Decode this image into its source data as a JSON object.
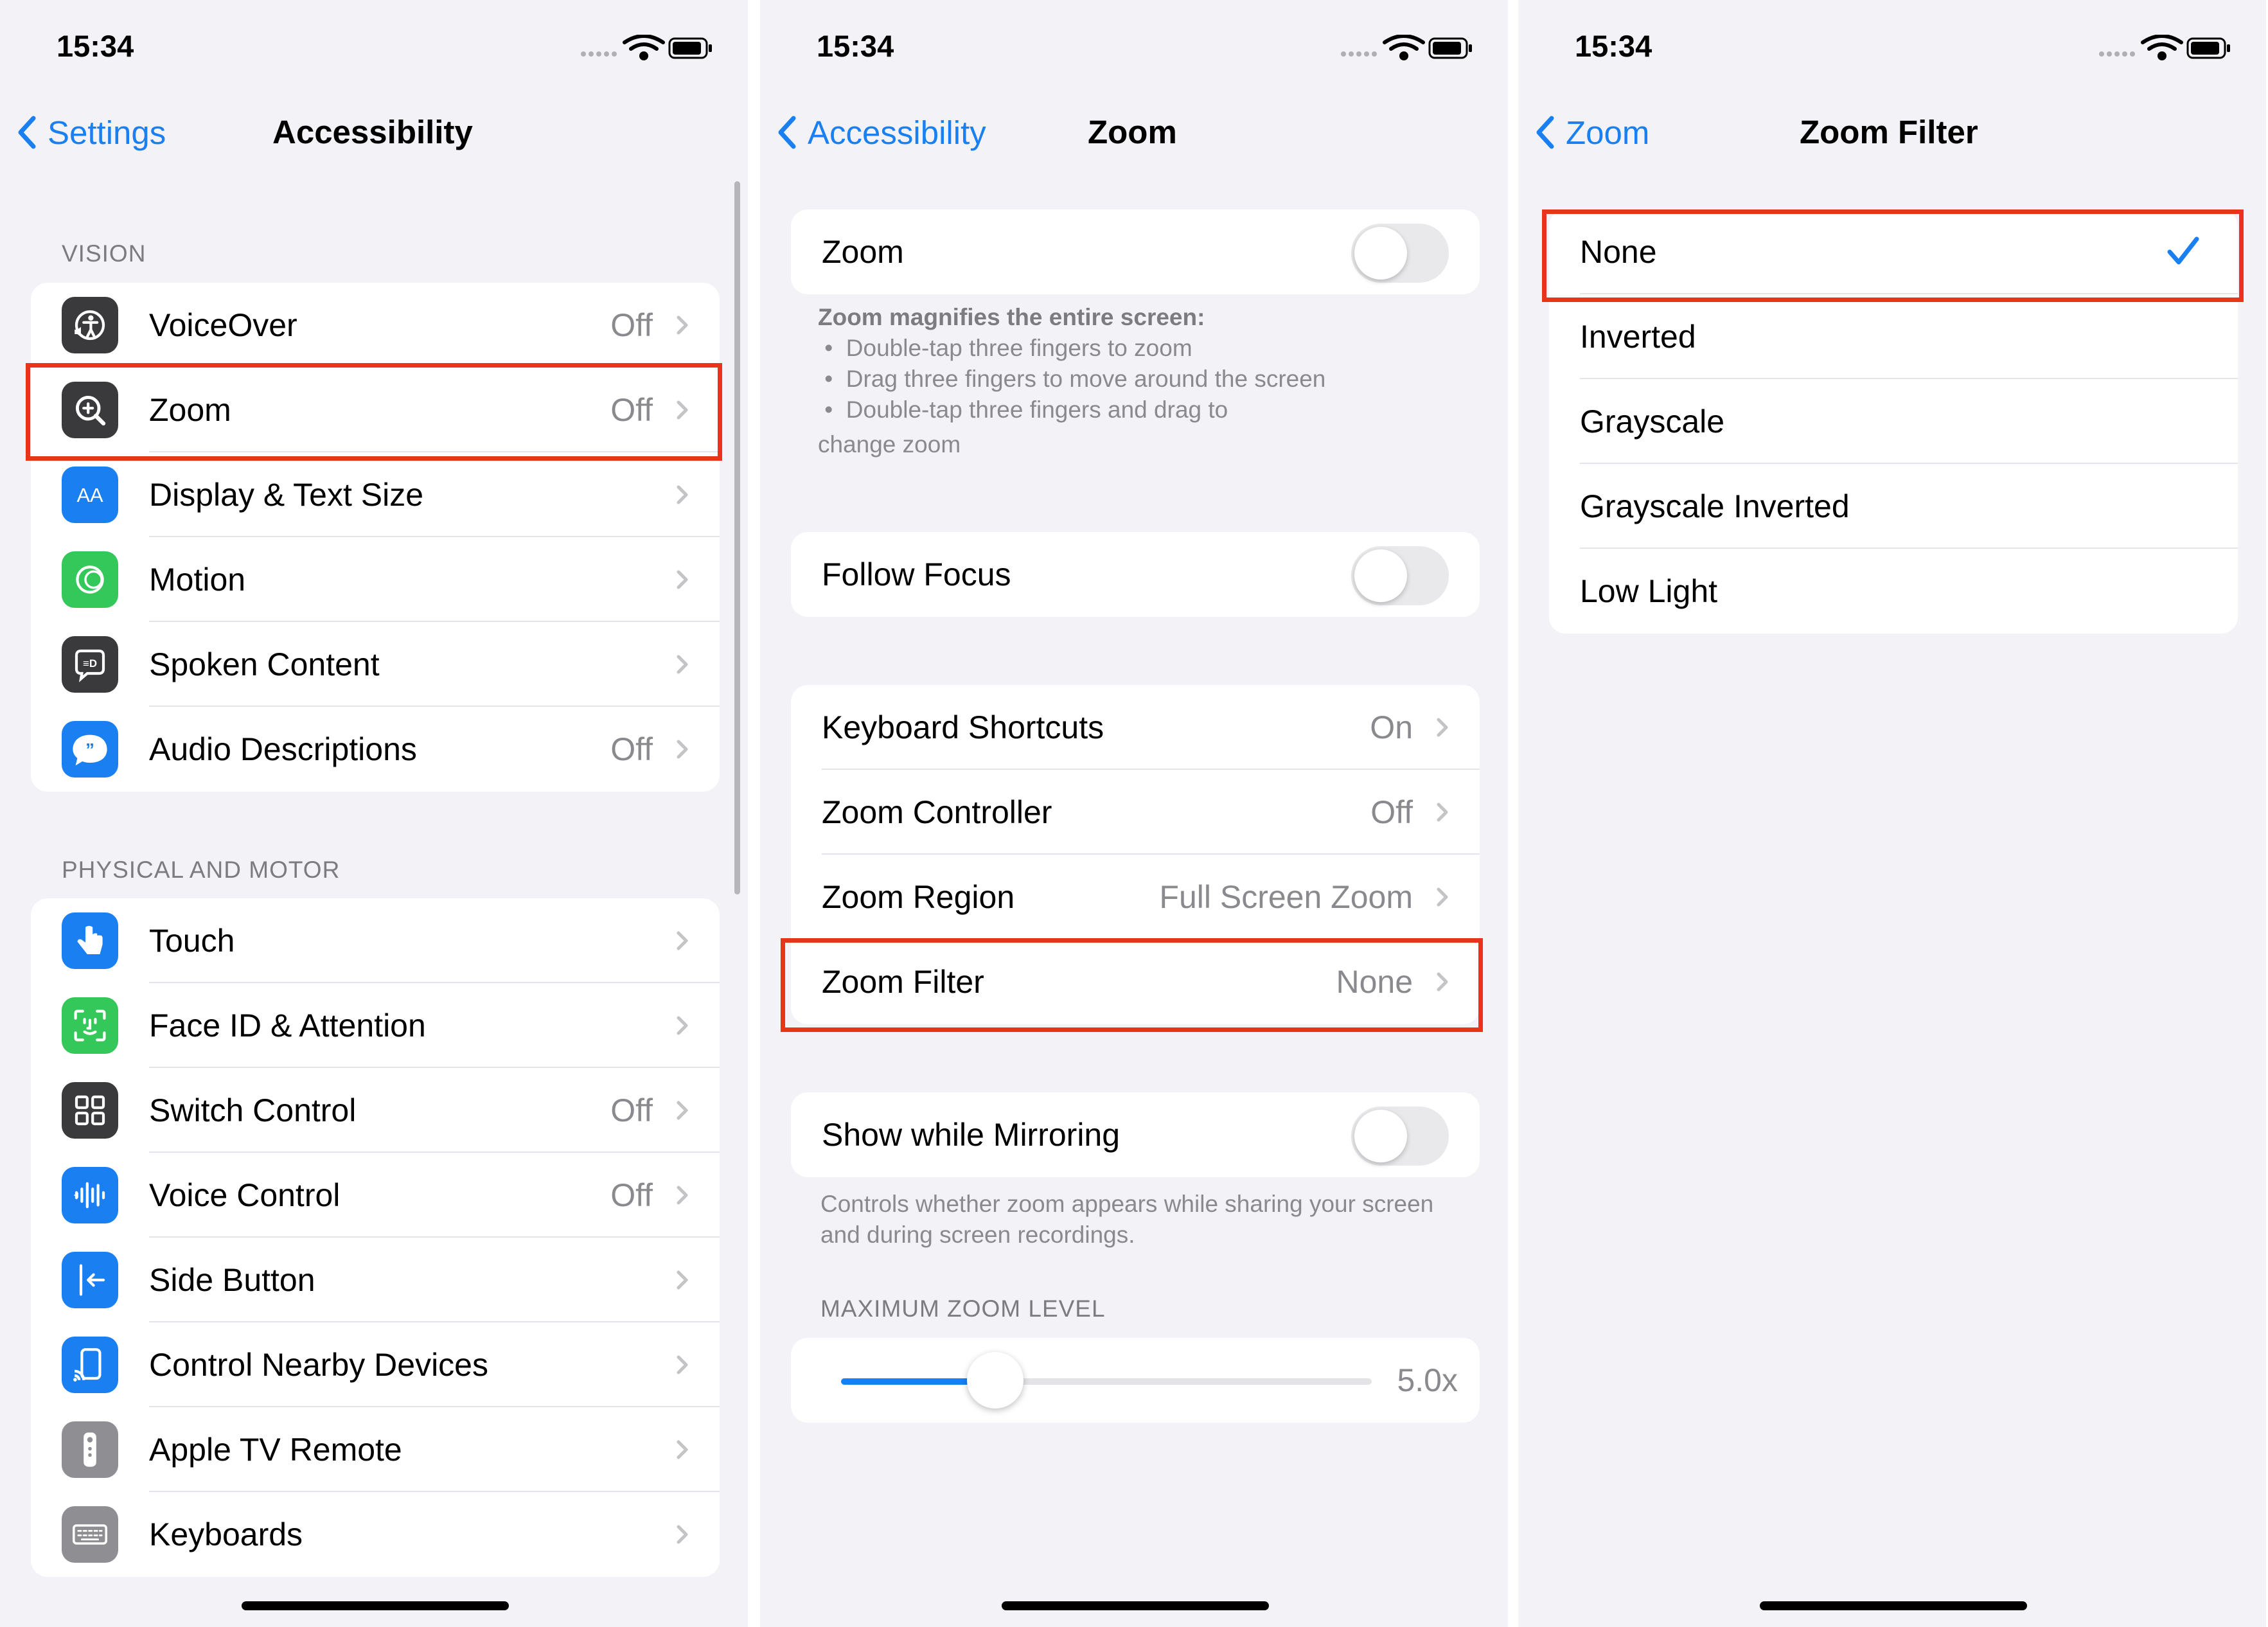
{
  "status": {
    "time": "15:34"
  },
  "colors": {
    "accent": "#1a7ff0",
    "highlight": "#e8341c",
    "background": "#f2f2f7"
  },
  "screen1": {
    "back_label": "Settings",
    "title": "Accessibility",
    "vision_header": "VISION",
    "vision_items": [
      {
        "label": "VoiceOver",
        "value": "Off",
        "icon": "voiceover-icon",
        "icon_color": "#3a3a3c"
      },
      {
        "label": "Zoom",
        "value": "Off",
        "icon": "zoom-icon",
        "icon_color": "#3a3a3c"
      },
      {
        "label": "Display & Text Size",
        "value": "",
        "icon": "text-size-icon",
        "icon_color": "#1a7ff0"
      },
      {
        "label": "Motion",
        "value": "",
        "icon": "motion-icon",
        "icon_color": "#34c759"
      },
      {
        "label": "Spoken Content",
        "value": "",
        "icon": "spoken-content-icon",
        "icon_color": "#3a3a3c"
      },
      {
        "label": "Audio Descriptions",
        "value": "Off",
        "icon": "audio-descriptions-icon",
        "icon_color": "#1a7ff0"
      }
    ],
    "motor_header": "PHYSICAL AND MOTOR",
    "motor_items": [
      {
        "label": "Touch",
        "value": "",
        "icon": "touch-icon",
        "icon_color": "#1a7ff0"
      },
      {
        "label": "Face ID & Attention",
        "value": "",
        "icon": "face-id-icon",
        "icon_color": "#34c759"
      },
      {
        "label": "Switch Control",
        "value": "Off",
        "icon": "switch-control-icon",
        "icon_color": "#3a3a3c"
      },
      {
        "label": "Voice Control",
        "value": "Off",
        "icon": "voice-control-icon",
        "icon_color": "#1a7ff0"
      },
      {
        "label": "Side Button",
        "value": "",
        "icon": "side-button-icon",
        "icon_color": "#1a7ff0"
      },
      {
        "label": "Control Nearby Devices",
        "value": "",
        "icon": "nearby-devices-icon",
        "icon_color": "#1a7ff0"
      },
      {
        "label": "Apple TV Remote",
        "value": "",
        "icon": "tv-remote-icon",
        "icon_color": "#8e8e93"
      },
      {
        "label": "Keyboards",
        "value": "",
        "icon": "keyboard-icon",
        "icon_color": "#8e8e93"
      }
    ]
  },
  "screen2": {
    "back_label": "Accessibility",
    "title": "Zoom",
    "zoom_toggle_label": "Zoom",
    "zoom_toggle_on": false,
    "zoom_note_title": "Zoom magnifies the entire screen:",
    "zoom_note_bullets": [
      "Double-tap three fingers to zoom",
      "Drag three fingers to move around the screen",
      "Double-tap three fingers and drag to"
    ],
    "zoom_note_tail": "change zoom",
    "follow_focus_label": "Follow Focus",
    "follow_focus_on": false,
    "settings": [
      {
        "label": "Keyboard Shortcuts",
        "value": "On"
      },
      {
        "label": "Zoom Controller",
        "value": "Off"
      },
      {
        "label": "Zoom Region",
        "value": "Full Screen Zoom"
      },
      {
        "label": "Zoom Filter",
        "value": "None"
      }
    ],
    "mirroring_label": "Show while Mirroring",
    "mirroring_on": false,
    "mirroring_note": "Controls whether zoom appears while sharing your screen and during screen recordings.",
    "max_zoom_header": "MAXIMUM ZOOM LEVEL",
    "max_zoom_value": "5.0x",
    "max_zoom_slider_fraction": 0.29
  },
  "screen3": {
    "back_label": "Zoom",
    "title": "Zoom Filter",
    "options": [
      "None",
      "Inverted",
      "Grayscale",
      "Grayscale Inverted",
      "Low Light"
    ],
    "selected": "None"
  }
}
